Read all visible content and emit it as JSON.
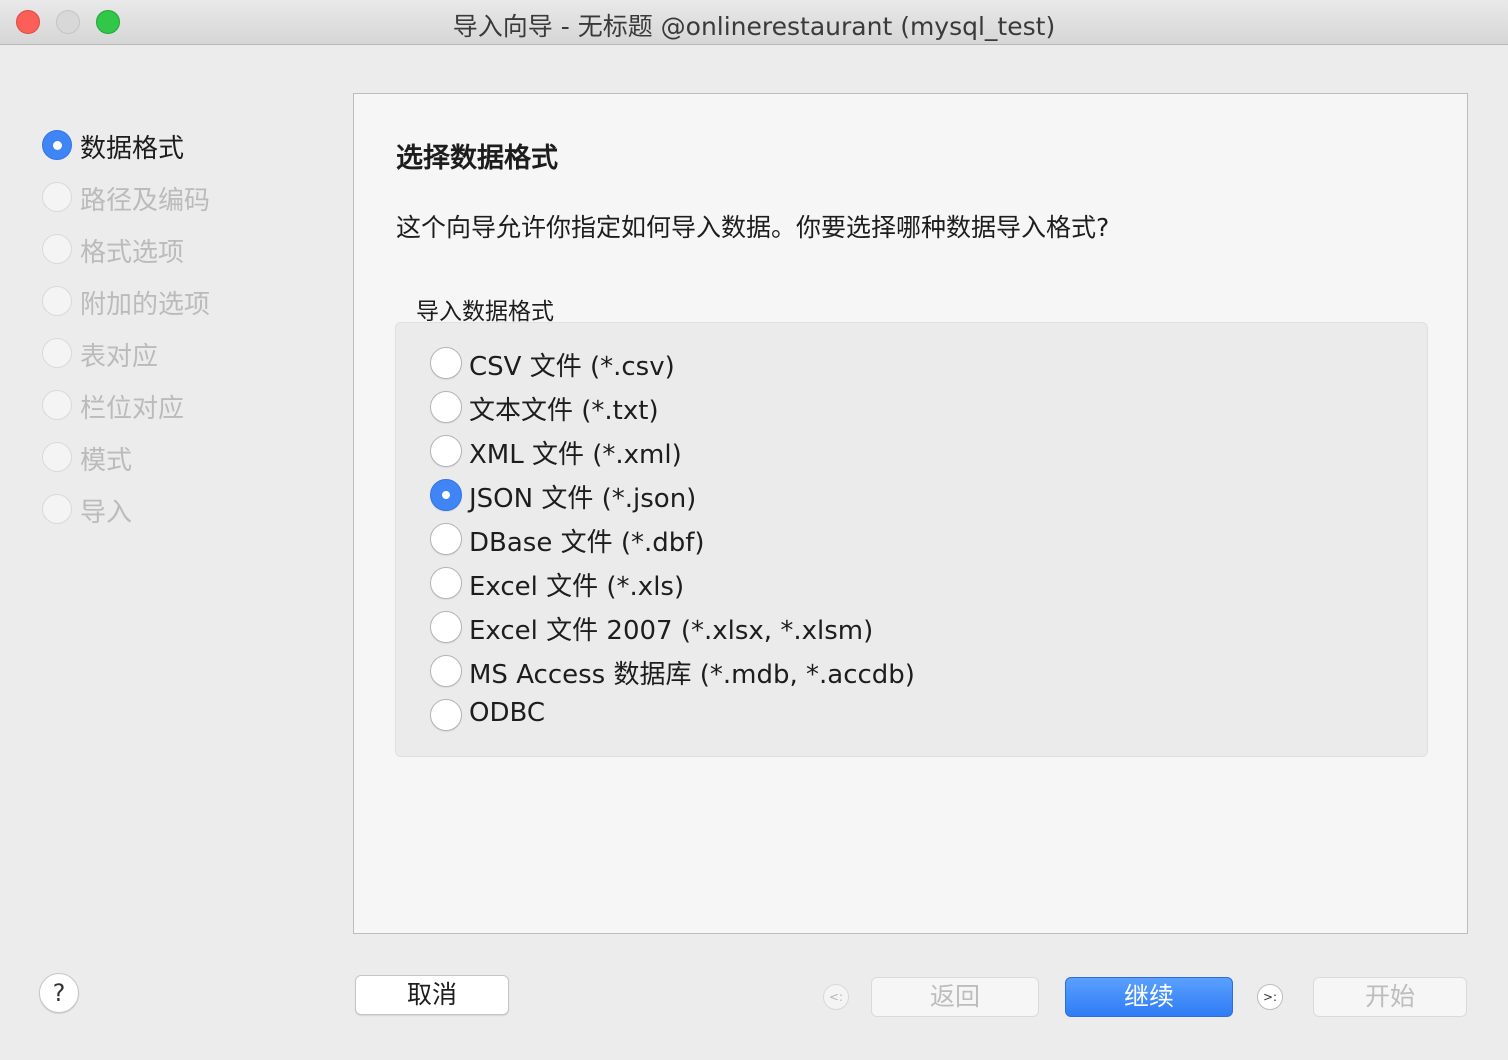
{
  "window": {
    "title": "导入向导 - 无标题 @onlinerestaurant (mysql_test)"
  },
  "steps": [
    {
      "label": "数据格式",
      "active": true
    },
    {
      "label": "路径及编码",
      "active": false
    },
    {
      "label": "格式选项",
      "active": false
    },
    {
      "label": "附加的选项",
      "active": false
    },
    {
      "label": "表对应",
      "active": false
    },
    {
      "label": "栏位对应",
      "active": false
    },
    {
      "label": "模式",
      "active": false
    },
    {
      "label": "导入",
      "active": false
    }
  ],
  "panel": {
    "title": "选择数据格式",
    "description": "这个向导允许你指定如何导入数据。你要选择哪种数据导入格式?",
    "group_label": "导入数据格式",
    "selected": "JSON 文件 (*.json)",
    "options": [
      "CSV 文件 (*.csv)",
      "文本文件 (*.txt)",
      "XML 文件 (*.xml)",
      "JSON 文件 (*.json)",
      "DBase 文件 (*.dbf)",
      "Excel 文件 (*.xls)",
      "Excel 文件 2007 (*.xlsx, *.xlsm)",
      "MS Access 数据库 (*.mdb, *.accdb)",
      "ODBC"
    ]
  },
  "footer": {
    "help_label": "?",
    "cancel_label": "取消",
    "prev_key": "<:",
    "back_label": "返回",
    "next_label": "继续",
    "next_key": ">:",
    "start_label": "开始"
  },
  "colors": {
    "accent": "#3f85f6",
    "disabled_text": "#bbbbbb"
  }
}
